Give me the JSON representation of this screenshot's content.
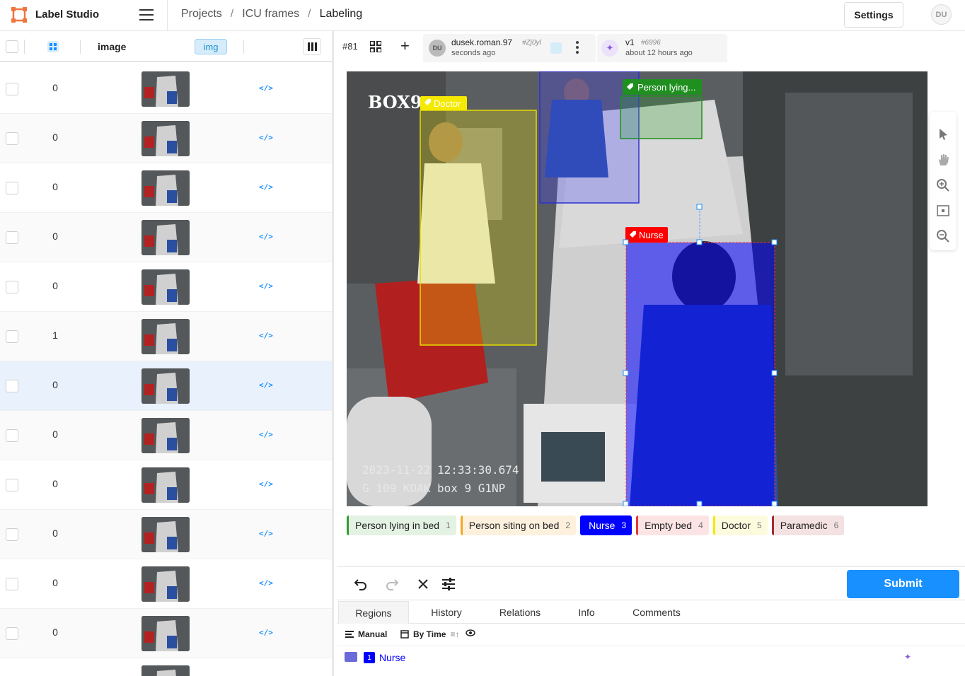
{
  "app": {
    "name": "Label Studio"
  },
  "breadcrumb": [
    "Projects",
    "ICU frames",
    "Labeling"
  ],
  "header": {
    "settings_label": "Settings",
    "user_initials": "DU"
  },
  "table": {
    "columns": {
      "image": "image",
      "img_badge": "img"
    },
    "rows": [
      {
        "value": "0",
        "code": "</>"
      },
      {
        "value": "0",
        "code": "</>"
      },
      {
        "value": "0",
        "code": "</>"
      },
      {
        "value": "0",
        "code": "</>"
      },
      {
        "value": "0",
        "code": "</>"
      },
      {
        "value": "1",
        "code": "</>"
      },
      {
        "value": "0",
        "code": "</>",
        "selected": true
      },
      {
        "value": "0",
        "code": "</>"
      },
      {
        "value": "0",
        "code": "</>"
      },
      {
        "value": "0",
        "code": "</>"
      },
      {
        "value": "0",
        "code": "</>"
      },
      {
        "value": "0",
        "code": "</>"
      },
      {
        "value": "",
        "code": ""
      }
    ]
  },
  "annotation": {
    "task_id": "#81",
    "user_initials": "DU",
    "user": "dusek.roman.97",
    "hash": "#Zj0yl",
    "time": "seconds ago",
    "prediction_version": "v1",
    "prediction_hash": "#6996",
    "prediction_time": "about 12 hours ago"
  },
  "image": {
    "overlay_camera": "BOX9",
    "overlay_timestamp": "2023-11-22 12:33:30.674",
    "overlay_id": "G 109 KOAK box 9 G1NP",
    "regions": [
      {
        "label": "Doctor",
        "color": "#f5e900"
      },
      {
        "label": "Person lying...",
        "color": "#1f8f1f"
      },
      {
        "label": "Nurse",
        "color": "#ff0000"
      }
    ]
  },
  "labels": [
    {
      "name": "Person lying in bed",
      "hotkey": "1",
      "color": "#2e9e2e",
      "bg": "#e4f2e4"
    },
    {
      "name": "Person siting on bed",
      "hotkey": "2",
      "color": "#f5a623",
      "bg": "#fdf1de"
    },
    {
      "name": "Nurse",
      "hotkey": "3",
      "color": "#0000ff",
      "bg": "#0000ff",
      "active": true
    },
    {
      "name": "Empty bed",
      "hotkey": "4",
      "color": "#e53935",
      "bg": "#fde4e4"
    },
    {
      "name": "Doctor",
      "hotkey": "5",
      "color": "#f5e900",
      "bg": "#fdfbde"
    },
    {
      "name": "Paramedic",
      "hotkey": "6",
      "color": "#a52a2a",
      "bg": "#f4e1e1"
    }
  ],
  "submit_label": "Submit",
  "tabs": [
    "Regions",
    "History",
    "Relations",
    "Info",
    "Comments"
  ],
  "region_toolbar": {
    "manual": "Manual",
    "by_time": "By Time"
  },
  "region_list": [
    {
      "index": "1",
      "label": "Nurse"
    }
  ]
}
